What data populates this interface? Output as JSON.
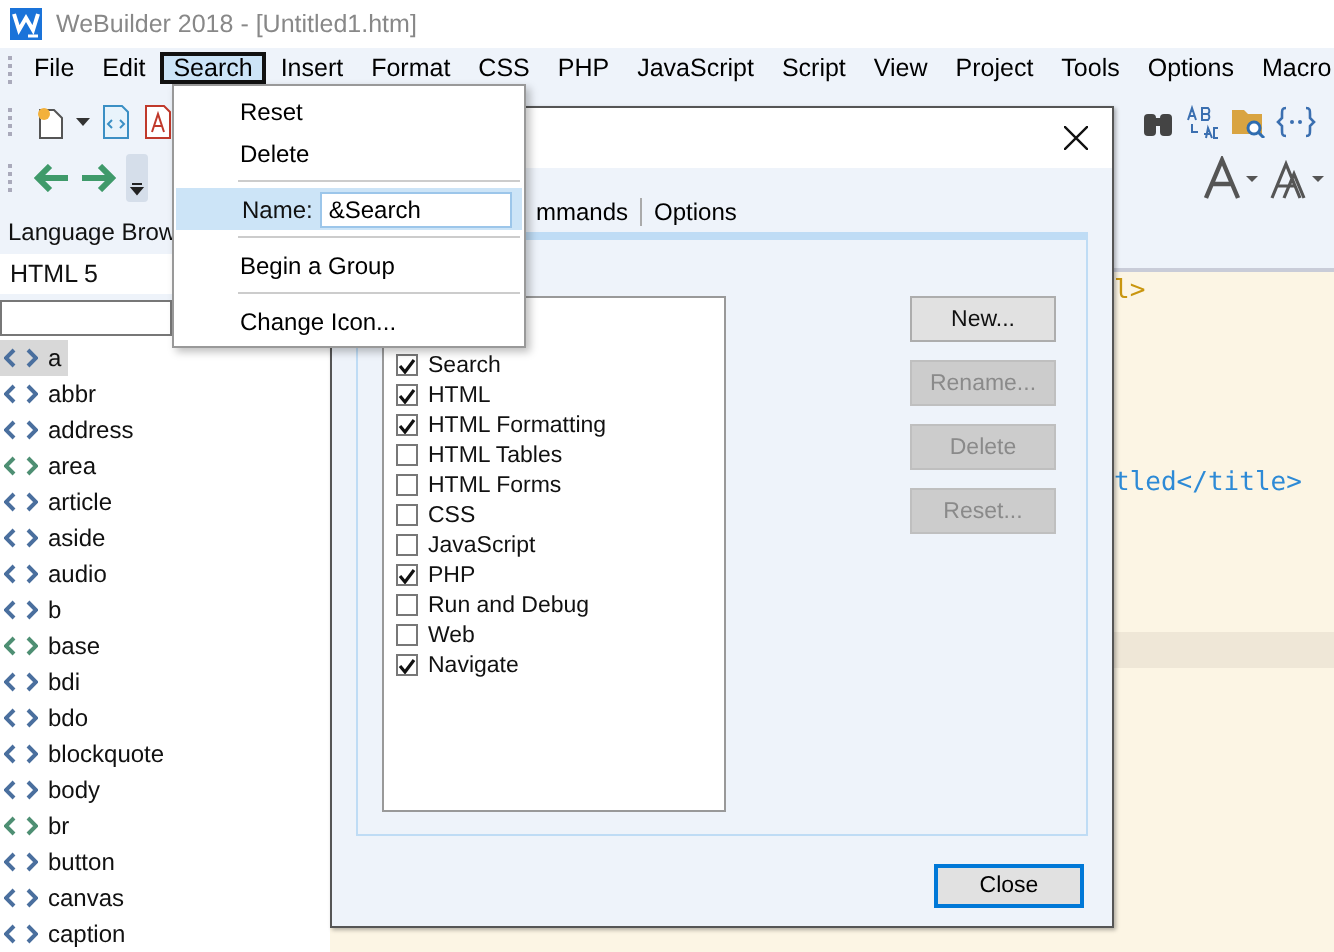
{
  "window": {
    "title": "WeBuilder 2018 - [Untitled1.htm]"
  },
  "menu_bar": [
    {
      "label": "File",
      "selected": false
    },
    {
      "label": "Edit",
      "selected": false
    },
    {
      "label": "Search",
      "selected": true
    },
    {
      "label": "Insert",
      "selected": false
    },
    {
      "label": "Format",
      "selected": false
    },
    {
      "label": "CSS",
      "selected": false
    },
    {
      "label": "PHP",
      "selected": false
    },
    {
      "label": "JavaScript",
      "selected": false
    },
    {
      "label": "Script",
      "selected": false
    },
    {
      "label": "View",
      "selected": false
    },
    {
      "label": "Project",
      "selected": false
    },
    {
      "label": "Tools",
      "selected": false
    },
    {
      "label": "Options",
      "selected": false
    },
    {
      "label": "Macro",
      "selected": false
    }
  ],
  "language_browser": {
    "title": "Language Brow",
    "language": "HTML 5",
    "items": [
      {
        "label": "a",
        "selected": true,
        "color": "#4a6f9e"
      },
      {
        "label": "abbr",
        "selected": false,
        "color": "#4a6f9e"
      },
      {
        "label": "address",
        "selected": false,
        "color": "#4a6f9e"
      },
      {
        "label": "area",
        "selected": false,
        "color": "#4e8f73"
      },
      {
        "label": "article",
        "selected": false,
        "color": "#4a6f9e"
      },
      {
        "label": "aside",
        "selected": false,
        "color": "#4a6f9e"
      },
      {
        "label": "audio",
        "selected": false,
        "color": "#4a6f9e"
      },
      {
        "label": "b",
        "selected": false,
        "color": "#4a6f9e"
      },
      {
        "label": "base",
        "selected": false,
        "color": "#4e8f73"
      },
      {
        "label": "bdi",
        "selected": false,
        "color": "#4a6f9e"
      },
      {
        "label": "bdo",
        "selected": false,
        "color": "#4a6f9e"
      },
      {
        "label": "blockquote",
        "selected": false,
        "color": "#4a6f9e"
      },
      {
        "label": "body",
        "selected": false,
        "color": "#4a6f9e"
      },
      {
        "label": "br",
        "selected": false,
        "color": "#4e8f73"
      },
      {
        "label": "button",
        "selected": false,
        "color": "#4a6f9e"
      },
      {
        "label": "canvas",
        "selected": false,
        "color": "#4a6f9e"
      },
      {
        "label": "caption",
        "selected": false,
        "color": "#4a6f9e"
      }
    ]
  },
  "editor": {
    "lines": [
      {
        "text": "l>",
        "kind": "tag"
      },
      {
        "text": "tled</title>",
        "kind": "mixed"
      }
    ]
  },
  "context_menu": {
    "items": [
      {
        "kind": "item",
        "label": "Reset"
      },
      {
        "kind": "item",
        "label": "Delete"
      },
      {
        "kind": "separator"
      },
      {
        "kind": "field",
        "label": "Name:",
        "value": "&Search"
      },
      {
        "kind": "separator"
      },
      {
        "kind": "item",
        "label": "Begin a Group"
      },
      {
        "kind": "separator"
      },
      {
        "kind": "item",
        "label": "Change Icon..."
      }
    ]
  },
  "dialog": {
    "tabs": [
      {
        "label": "mmands"
      },
      {
        "label": "Options"
      }
    ],
    "toolbars": [
      {
        "label": "Search",
        "checked": true
      },
      {
        "label": "HTML",
        "checked": true
      },
      {
        "label": "HTML Formatting",
        "checked": true
      },
      {
        "label": "HTML Tables",
        "checked": false
      },
      {
        "label": "HTML Forms",
        "checked": false
      },
      {
        "label": "CSS",
        "checked": false
      },
      {
        "label": "JavaScript",
        "checked": false
      },
      {
        "label": "PHP",
        "checked": true
      },
      {
        "label": "Run and Debug",
        "checked": false
      },
      {
        "label": "Web",
        "checked": false
      },
      {
        "label": "Navigate",
        "checked": true
      }
    ],
    "buttons": [
      {
        "label": "New...",
        "disabled": false
      },
      {
        "label": "Rename...",
        "disabled": true
      },
      {
        "label": "Delete",
        "disabled": true
      },
      {
        "label": "Reset...",
        "disabled": true
      }
    ],
    "close_button": "Close"
  }
}
